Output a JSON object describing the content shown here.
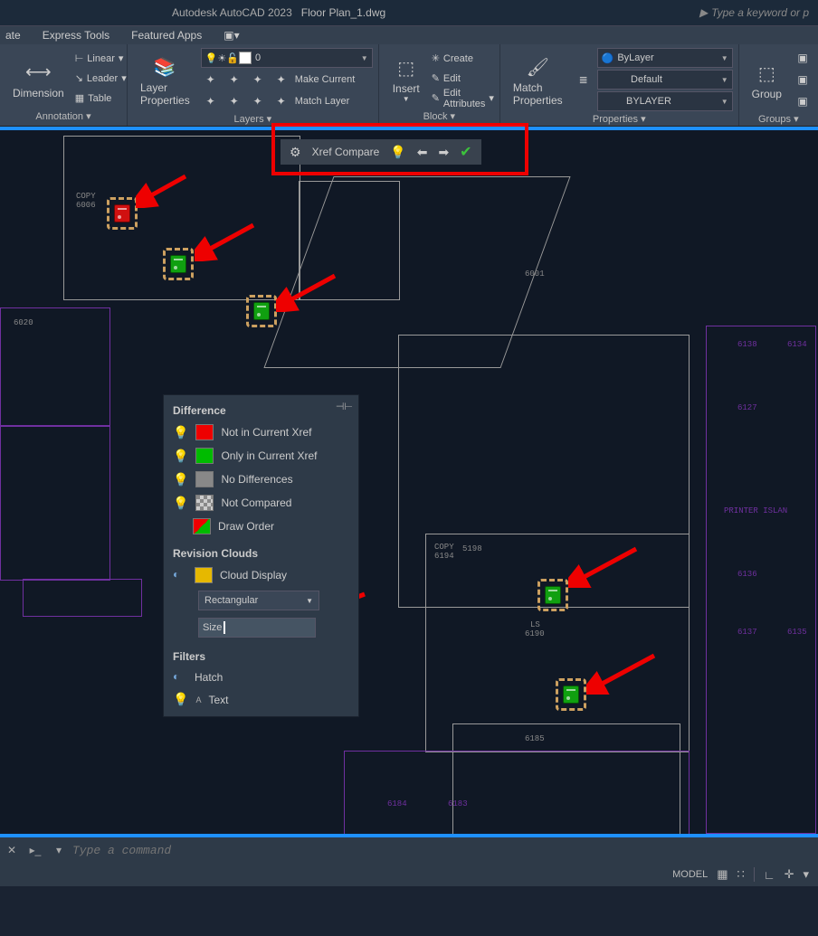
{
  "title": {
    "app": "Autodesk AutoCAD 2023",
    "file": "Floor Plan_1.dwg",
    "search_ph": "Type a keyword or p"
  },
  "tabs": {
    "t1": "ate",
    "t2": "Express Tools",
    "t3": "Featured Apps"
  },
  "annotation": {
    "linear": "Linear",
    "leader": "Leader",
    "table": "Table",
    "dimension": "Dimension",
    "panel": "Annotation"
  },
  "layers": {
    "btn": "Layer\nProperties",
    "make_current": "Make Current",
    "match_layer": "Match Layer",
    "zero": "0",
    "panel": "Layers"
  },
  "block": {
    "insert": "Insert",
    "create": "Create",
    "edit": "Edit",
    "edit_attr": "Edit Attributes",
    "panel": "Block"
  },
  "properties": {
    "match": "Match\nProperties",
    "bylayer": "ByLayer",
    "default": "Default",
    "bylayer_lt": "BYLAYER",
    "panel": "Properties"
  },
  "groups": {
    "group": "Group",
    "panel": "Groups"
  },
  "xref": {
    "label": "Xref Compare"
  },
  "diffpanel": {
    "hdr1": "Difference",
    "r1": "Not in Current Xref",
    "r2": "Only in Current Xref",
    "r3": "No Differences",
    "r4": "Not Compared",
    "r5": "Draw Order",
    "hdr2": "Revision Clouds",
    "cloud": "Cloud Display",
    "shape": "Rectangular",
    "size": "Size",
    "hdr3": "Filters",
    "hatch": "Hatch",
    "text": "Text"
  },
  "rooms": {
    "printer": "PRINTER ISLAN",
    "copy": "COPY",
    "num1": "6006",
    "num2": "6020",
    "num3": "6001",
    "num4": "5198",
    "num5": "6194",
    "num6": "6190",
    "num7": "6185",
    "ls": "LS",
    "n8": "6138",
    "n9": "6134",
    "n10": "6127",
    "n11": "6136",
    "n12": "6137",
    "n13": "6135",
    "n14": "6183",
    "n15": "6184"
  },
  "cmd": {
    "ph": "Type a command"
  },
  "status": {
    "model": "MODEL"
  }
}
